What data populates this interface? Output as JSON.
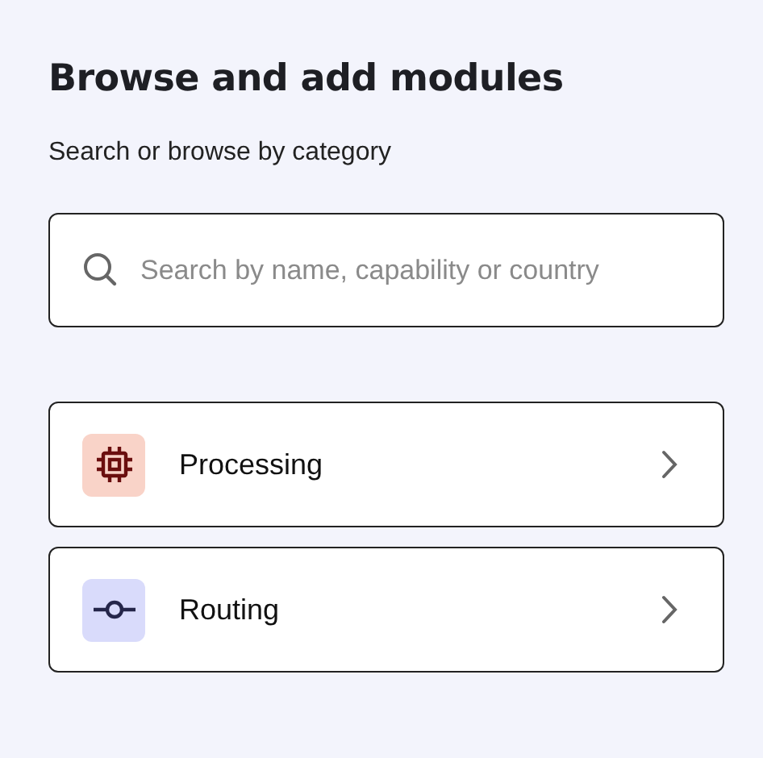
{
  "title": "Browse and add modules",
  "subtitle": "Search or browse by category",
  "search": {
    "placeholder": "Search by name, capability or country"
  },
  "categories": [
    {
      "label": "Processing",
      "kind": "chip",
      "color": "#f9d3c8"
    },
    {
      "label": "Routing",
      "kind": "node",
      "color": "#d9dbfb"
    }
  ]
}
